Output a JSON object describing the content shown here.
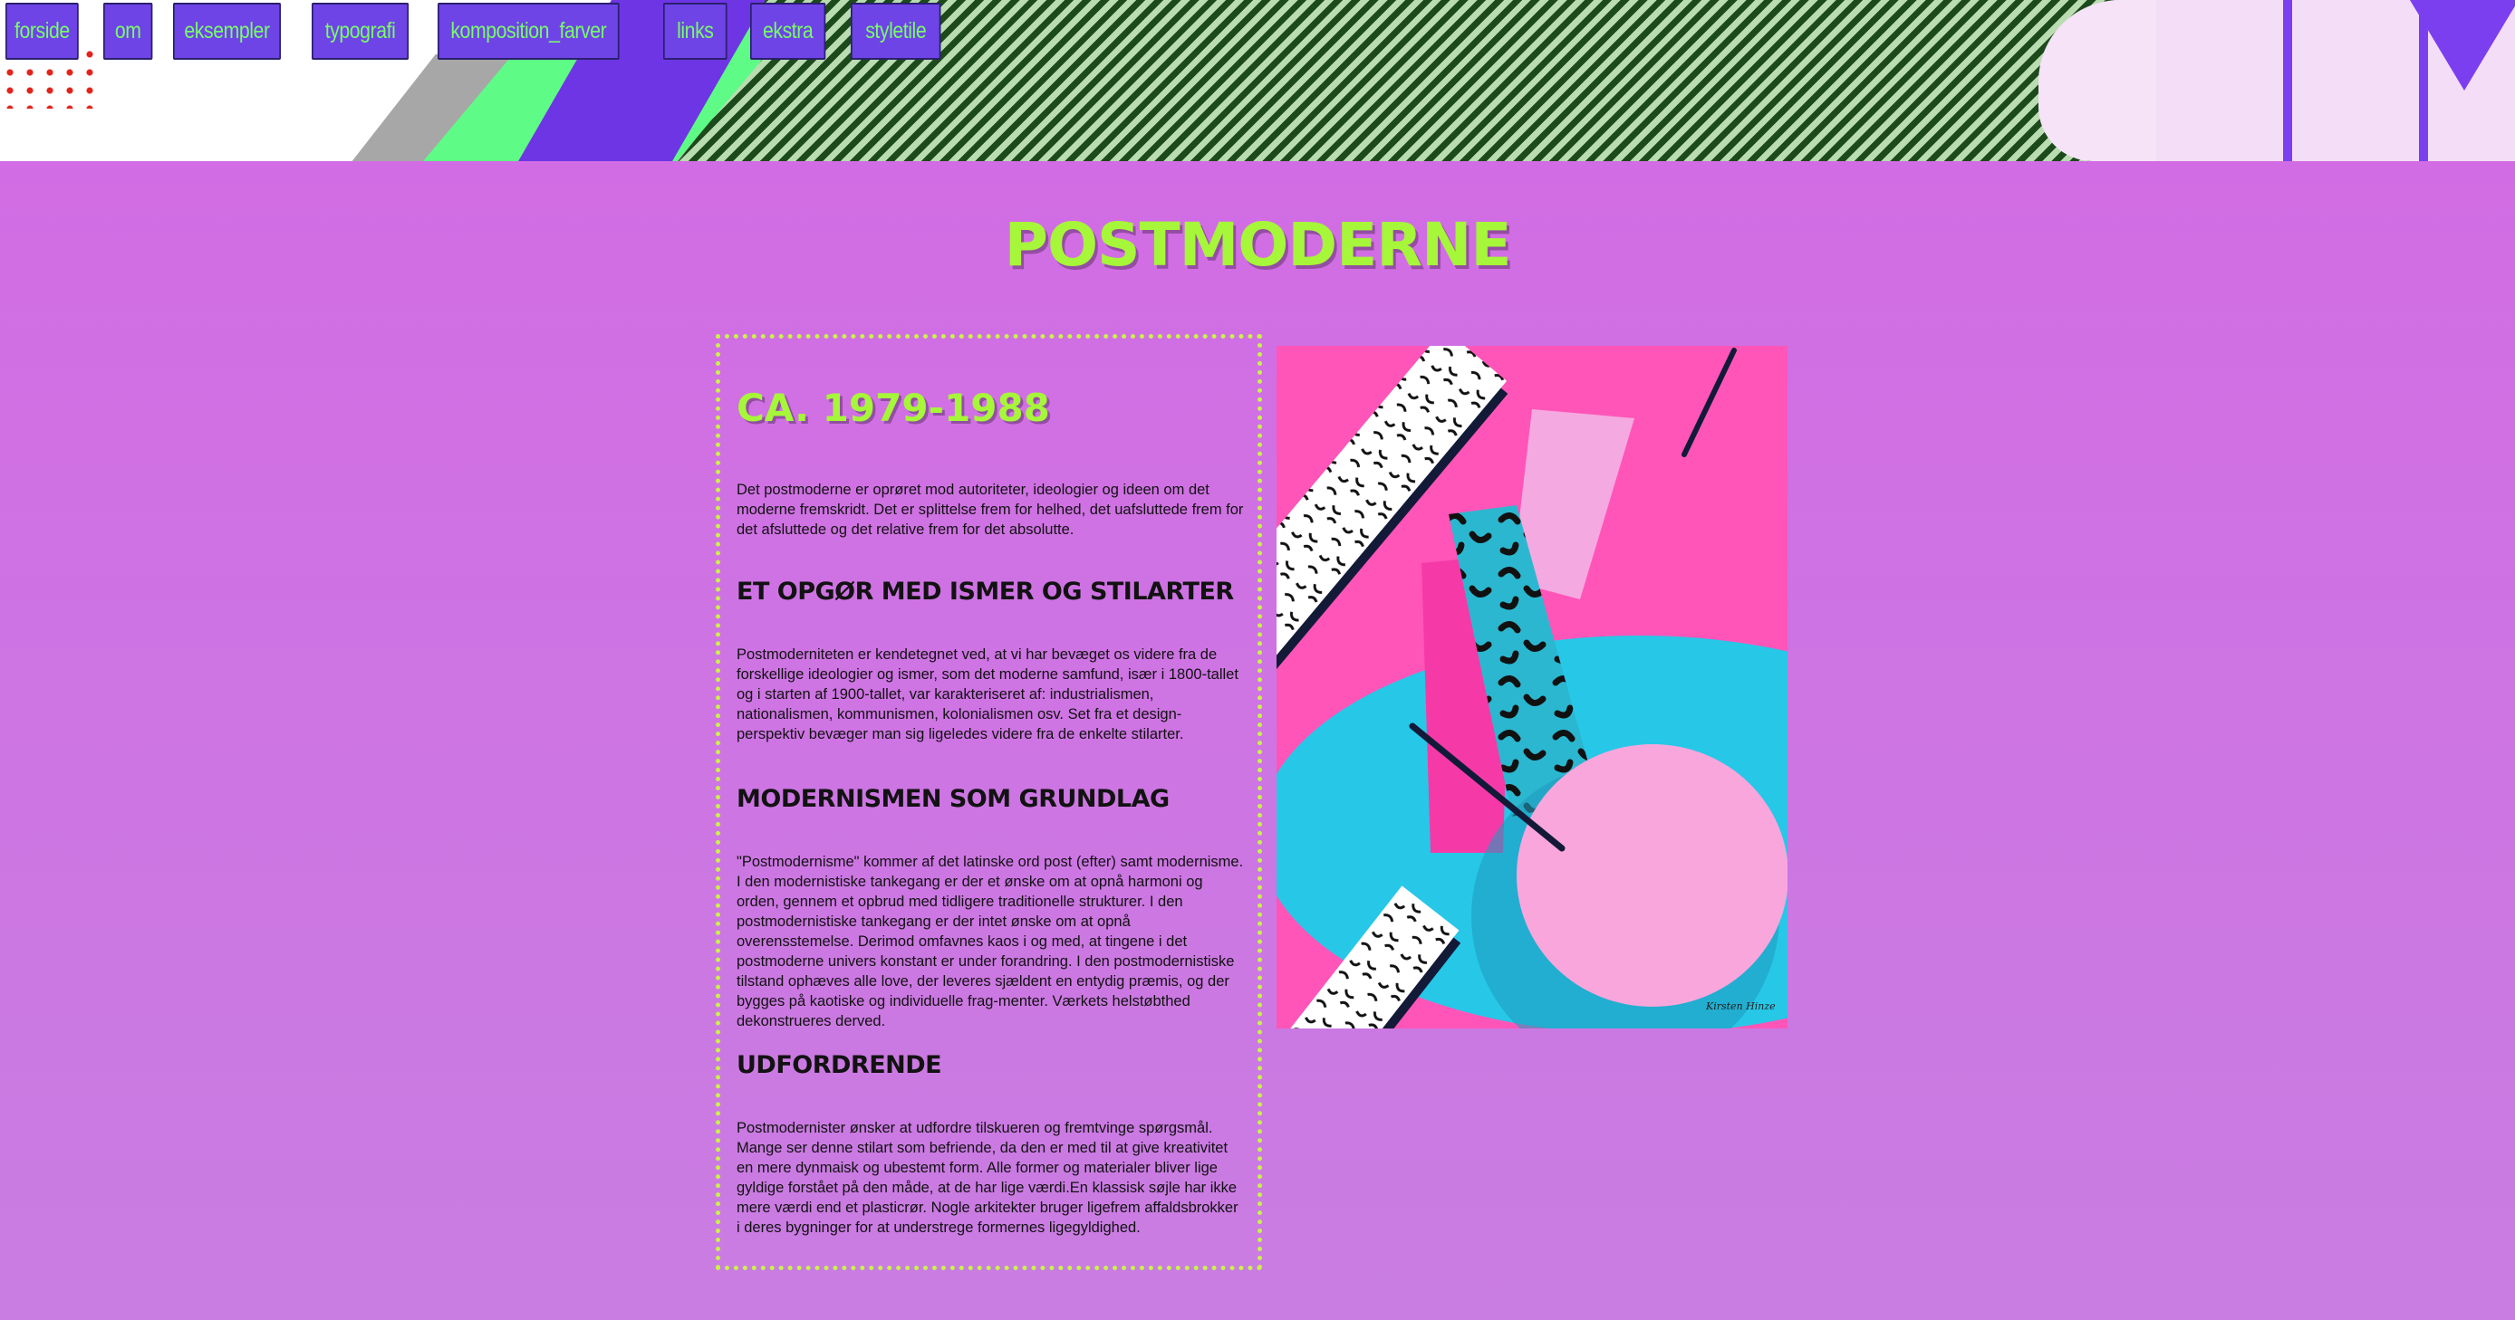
{
  "nav": {
    "items": [
      "forside",
      "om",
      "eksempler",
      "typografi",
      "komposition_farver",
      "links",
      "ekstra",
      "styletile"
    ]
  },
  "page": {
    "title": "POSTMODERNE"
  },
  "content": {
    "era": "CA. 1979-1988",
    "intro": "Det postmoderne er oprøret mod autoriteter, ideologier og ideen om det moderne fremskridt. Det er splittelse frem for helhed, det uafsluttede frem for det afsluttede og det relative frem for det absolutte.",
    "sections": [
      {
        "heading": "ET OPGØR MED ISMER OG STILARTER",
        "text": "Postmoderniteten er kendetegnet ved, at vi har bevæget os videre fra de forskellige ideologier og ismer, som det moderne samfund, især i 1800-tallet og i starten af 1900-tallet, var karakteriseret af: industrialismen, nationalismen, kommunismen, kolonialismen osv. Set fra et design-perspektiv bevæger man sig ligeledes videre fra de enkelte stilarter."
      },
      {
        "heading": "MODERNISMEN SOM GRUNDLAG",
        "text": "\"Postmodernisme\" kommer af det latinske ord post (efter) samt modernisme. I den modernistiske tankegang er der et ønske om at opnå harmoni og orden, gennem et opbrud med tidligere traditionelle strukturer. I den postmodernistiske tankegang er der intet ønske om at opnå overensstemelse. Derimod omfavnes kaos i og med, at tingene i det postmoderne univers konstant er under forandring. I den postmodernistiske tilstand ophæves alle love, der leveres sjældent en entydig præmis, og der bygges på kaotiske og individuelle frag-menter. Værkets helstøbthed dekonstrueres derved."
      },
      {
        "heading": "UDFORDRENDE",
        "text": "Postmodernister ønsker at udfordre tilskueren og fremtvinge spørgsmål. Mange ser denne stilart som befriende, da den er med til at give kreativitet en mere dynmaisk og ubestemt form. Alle former og materialer bliver lige gyldige forstået på den måde, at de har lige værdi.En klassisk søjle har ikke mere værdi end et plasticrør. Nogle arkitekter bruger ligefrem affaldsbrokker i deres bygninger for at understrege formernes ligegyldighed."
      }
    ]
  },
  "artwork": {
    "subject": "memphis-style-geometric-illustration",
    "signature": "Kirsten Hinze",
    "colors": {
      "pink": "#ff55b8",
      "cyan": "#27c7e8",
      "light_pink": "#f9a6dc",
      "navy": "#131a38"
    }
  },
  "colors": {
    "background": "#d36ae4",
    "title_green": "#a6f63a",
    "nav_bg": "#6e44e6",
    "nav_text": "#78fb6b",
    "box_border": "#c9f24a"
  }
}
